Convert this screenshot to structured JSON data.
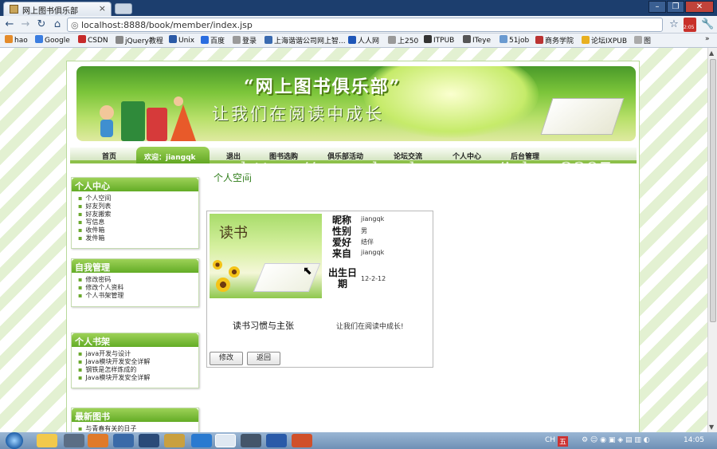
{
  "browser": {
    "tab_title": "网上图书俱乐部",
    "url": "localhost:8888/book/member/index.jsp",
    "bookmarks": [
      "hao",
      "Google",
      "CSDN",
      "jQuery教程",
      "Unix",
      "百度",
      "登录",
      "上海谐谐公司网上智...",
      "人人网",
      "上250",
      "ITPUB",
      "ITeye",
      "51job",
      "商务学院",
      "论坛IXPUB",
      "图"
    ],
    "badge": "2:05"
  },
  "banner": {
    "title": "“网上图书俱乐部”",
    "slogan": "让我们在阅读中成长",
    "watermark": "https://www.huzhan.com/ishop3397"
  },
  "menu": {
    "items": [
      "首页",
      "欢迎：jiangqk",
      "退出",
      "图书选购",
      "俱乐部活动",
      "论坛交流",
      "个人中心",
      "后台管理"
    ]
  },
  "sidebar": {
    "personal": {
      "title": "个人中心",
      "items": [
        "个人空间",
        "好友列表",
        "好友搬索",
        "写信息",
        "收件箱",
        "发件箱"
      ]
    },
    "self_manage": {
      "title": "自我管理",
      "items": [
        "修改密码",
        "修改个人资料",
        "个人书架管理"
      ]
    },
    "bookshelf": {
      "title": "个人书架",
      "items": [
        "java开发与设计",
        "Java模块开发安全详解",
        "钢铁是怎样炼成的",
        "Java模块开发安全详解"
      ]
    },
    "new_books": {
      "title": "最新图书",
      "items": [
        "与青春有关的日子"
      ]
    }
  },
  "main": {
    "breadcrumb": "个人空间",
    "profile": {
      "image_text": "读书",
      "labels": {
        "nickname": "昵称",
        "gender": "性别",
        "hobby": "爱好",
        "from": "来自",
        "birthday": "出生日期"
      },
      "values": {
        "nickname": "jiangqk",
        "gender": "男",
        "hobby": "结伴",
        "from": "jiangqk",
        "birthday": "12-2-12"
      },
      "caption_left": "读书习惯与主张",
      "caption_right": "让我们在阅读中成长!",
      "edit_button": "修改",
      "back_button": "返回"
    }
  },
  "taskbar": {
    "clock": "14:05",
    "lang": "CH"
  },
  "colors": {
    "accent_green": "#63ac26",
    "title_bar": "#1c3e6e",
    "taskbar": "#6f90b5"
  }
}
